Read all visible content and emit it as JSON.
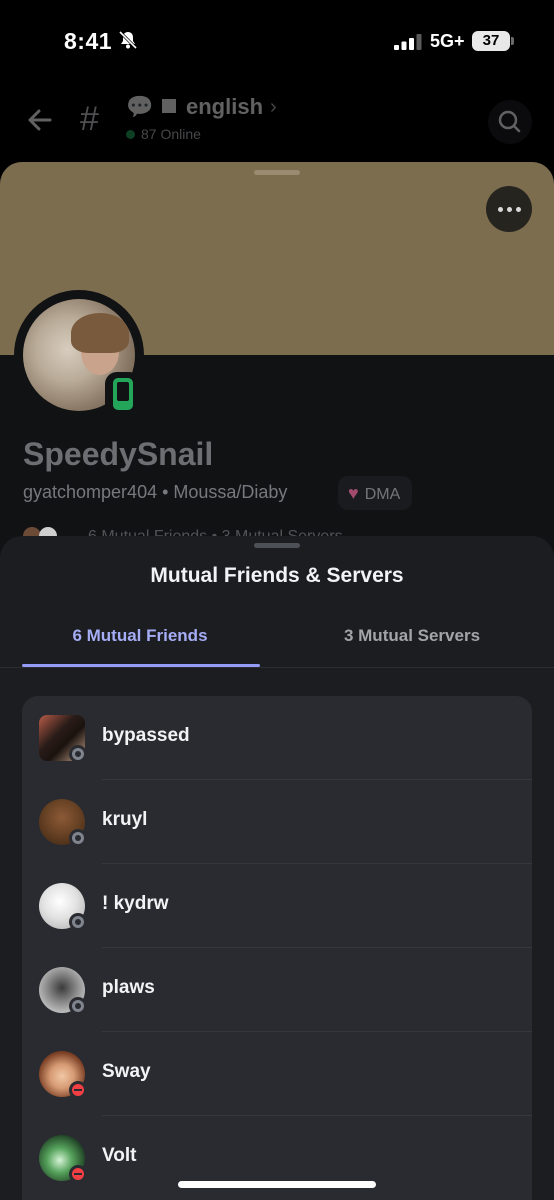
{
  "status_bar": {
    "time": "8:41",
    "network": "5G+",
    "battery": "37"
  },
  "channel": {
    "name": "english",
    "online": "87 Online",
    "emoji": "💬"
  },
  "profile": {
    "display_name": "SpeedySnail",
    "handle_line": "gyatchomper404 • Moussa/Diaby",
    "badge_label": "DMA",
    "peek_text": "6 Mutual Friends  •  3 Mutual Servers"
  },
  "sheet": {
    "title": "Mutual Friends & Servers",
    "tabs": [
      {
        "label": "6 Mutual Friends",
        "selected": true
      },
      {
        "label": "3 Mutual Servers",
        "selected": false
      }
    ],
    "friends": [
      {
        "name": "bypassed",
        "status": "offline"
      },
      {
        "name": "kruyl",
        "status": "offline"
      },
      {
        "name": "! kydrw",
        "status": "offline"
      },
      {
        "name": "plaws",
        "status": "offline"
      },
      {
        "name": "Sway",
        "status": "do-not-disturb"
      },
      {
        "name": "Volt",
        "status": "do-not-disturb"
      }
    ]
  },
  "colors": {
    "accent": "#949cf7",
    "online": "#23a55a",
    "dnd": "#f23f43",
    "offline": "#80848e",
    "banner": "#7d6d4f"
  }
}
